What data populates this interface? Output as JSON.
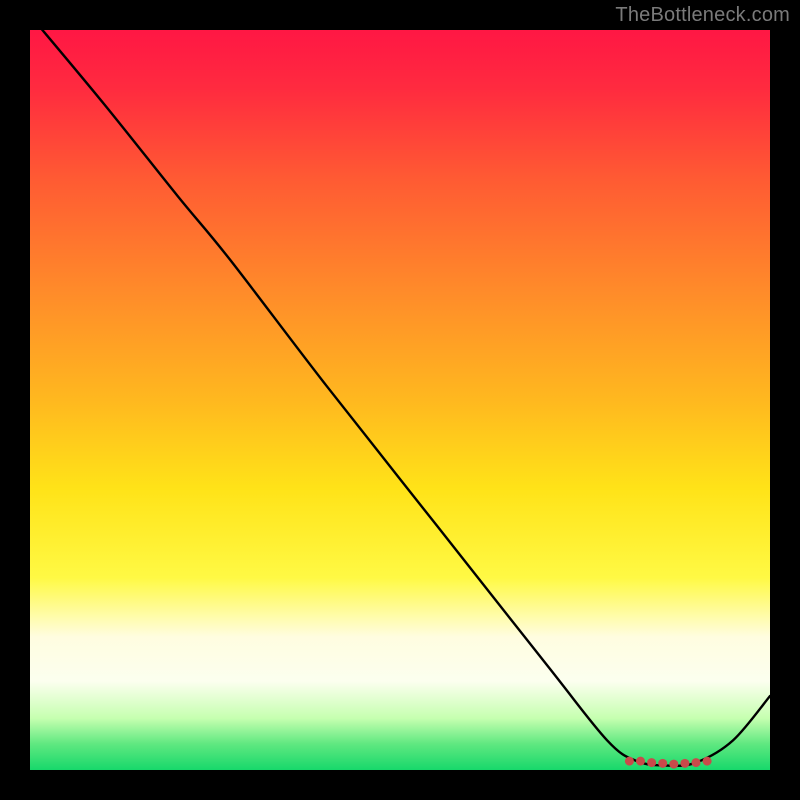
{
  "attribution": "TheBottleneck.com",
  "chart_data": {
    "type": "line",
    "title": "",
    "xlabel": "",
    "ylabel": "",
    "xlim": [
      0,
      100
    ],
    "ylim": [
      0,
      100
    ],
    "series": [
      {
        "name": "curve",
        "x": [
          0,
          10,
          20,
          27,
          40,
          55,
          70,
          78,
          82,
          86,
          90,
          95,
          100
        ],
        "y": [
          102,
          90,
          77.5,
          69,
          52,
          33,
          14,
          4,
          1.2,
          0.6,
          1.0,
          4,
          10
        ]
      }
    ],
    "scatter": {
      "name": "dotted-band",
      "color": "#c94a4a",
      "x": [
        81,
        82.5,
        84,
        85.5,
        87,
        88.5,
        90,
        91.5
      ],
      "y": [
        1.2,
        1.2,
        1.0,
        0.9,
        0.8,
        0.9,
        1.0,
        1.2
      ]
    },
    "background": {
      "type": "vertical-gradient",
      "stops": [
        {
          "offset": 0.0,
          "color": "#ff1744"
        },
        {
          "offset": 0.08,
          "color": "#ff2b3f"
        },
        {
          "offset": 0.2,
          "color": "#ff5a33"
        },
        {
          "offset": 0.35,
          "color": "#ff8a2a"
        },
        {
          "offset": 0.5,
          "color": "#ffb81f"
        },
        {
          "offset": 0.62,
          "color": "#ffe318"
        },
        {
          "offset": 0.74,
          "color": "#fff944"
        },
        {
          "offset": 0.82,
          "color": "#fffde0"
        },
        {
          "offset": 0.88,
          "color": "#fcffef"
        },
        {
          "offset": 0.93,
          "color": "#c6ffb0"
        },
        {
          "offset": 0.965,
          "color": "#5fe880"
        },
        {
          "offset": 1.0,
          "color": "#17d86b"
        }
      ]
    }
  }
}
